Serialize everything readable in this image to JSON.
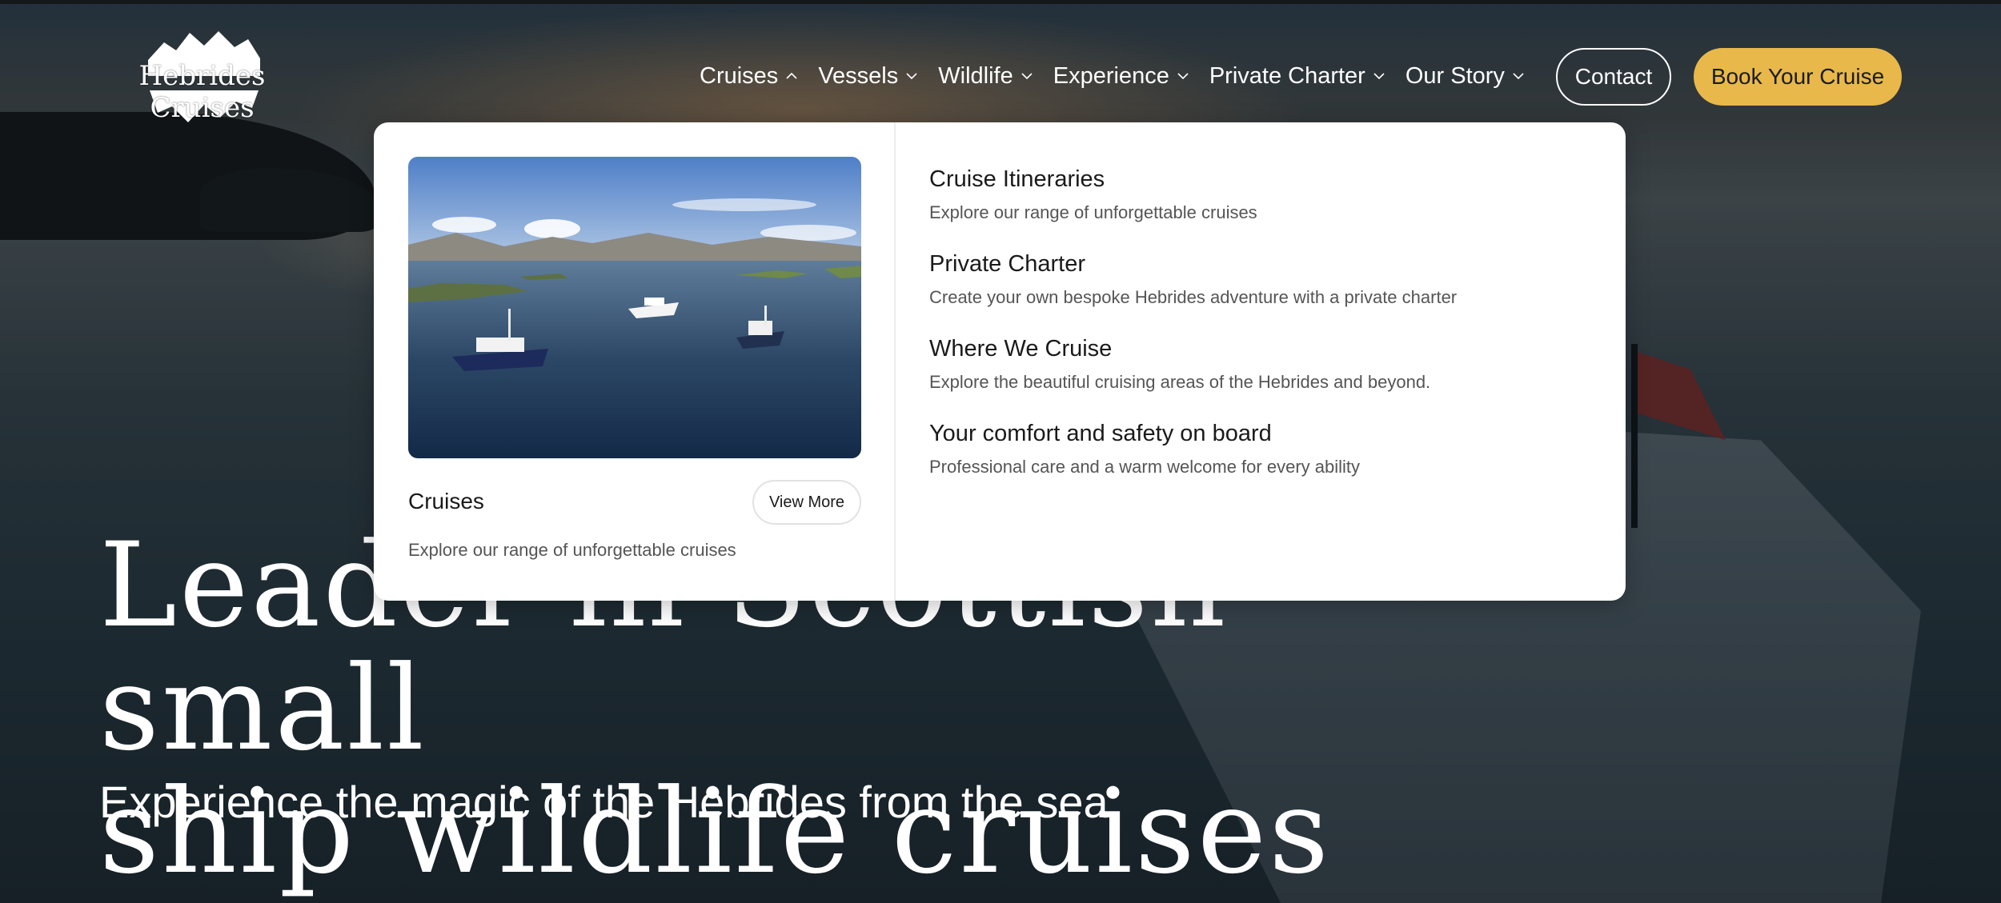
{
  "brand": {
    "logo_text": "Hebrides Cruises",
    "accent_color": "#e8b84a"
  },
  "nav": {
    "items": [
      {
        "label": "Cruises",
        "icon": "chevron-up-icon"
      },
      {
        "label": "Vessels",
        "icon": "chevron-down-icon"
      },
      {
        "label": "Wildlife",
        "icon": "chevron-down-icon"
      },
      {
        "label": "Experience",
        "icon": "chevron-down-icon"
      },
      {
        "label": "Private Charter",
        "icon": "chevron-down-icon"
      },
      {
        "label": "Our Story",
        "icon": "chevron-down-icon"
      }
    ],
    "contact_label": "Contact",
    "book_label": "Book Your Cruise"
  },
  "dropdown": {
    "card": {
      "title": "Cruises",
      "button_label": "View More",
      "description": "Explore our range of unforgettable cruises"
    },
    "links": [
      {
        "title": "Cruise Itineraries",
        "description": "Explore our range of unforgettable cruises"
      },
      {
        "title": "Private Charter",
        "description": "Create your own bespoke Hebrides adventure with a private charter"
      },
      {
        "title": "Where We Cruise",
        "description": "Explore the beautiful cruising areas of the Hebrides and beyond."
      },
      {
        "title": "Your comfort and safety on board",
        "description": "Professional care and a warm welcome for every ability"
      }
    ]
  },
  "hero": {
    "title_line1": "Leader in Scottish small",
    "title_line2": "ship wildlife cruises",
    "subtitle": "Experience the magic of the Hebrides from the sea"
  }
}
